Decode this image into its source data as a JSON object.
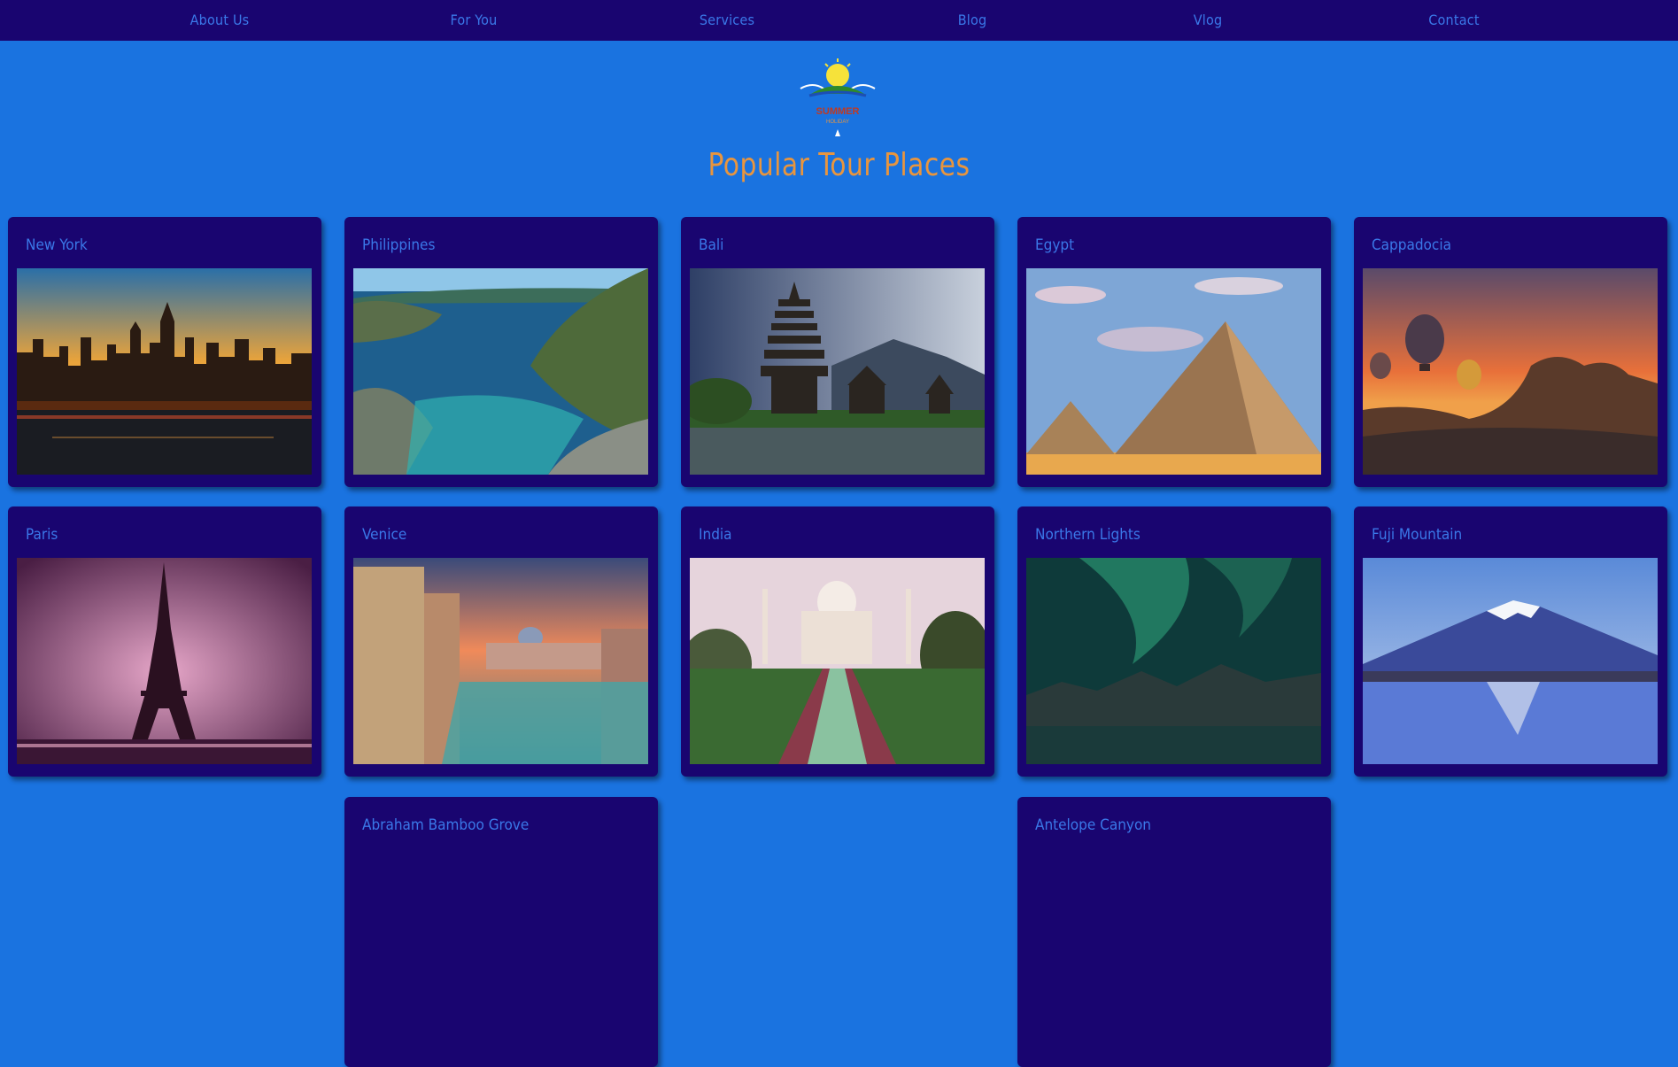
{
  "nav": {
    "items": [
      {
        "label": "About Us"
      },
      {
        "label": "For You"
      },
      {
        "label": "Services"
      },
      {
        "label": "Blog"
      },
      {
        "label": "Vlog"
      },
      {
        "label": "Contact"
      }
    ]
  },
  "logo": {
    "text_main": "SUMMER",
    "text_sub": "HOLIDAY"
  },
  "page_title": "Popular Tour Places",
  "places": [
    {
      "name": "New York"
    },
    {
      "name": "Philippines"
    },
    {
      "name": "Bali"
    },
    {
      "name": "Egypt"
    },
    {
      "name": "Cappadocia"
    },
    {
      "name": "Paris"
    },
    {
      "name": "Venice"
    },
    {
      "name": "India"
    },
    {
      "name": "Northern Lights"
    },
    {
      "name": "Fuji Mountain"
    },
    {
      "name": "Abraham Bamboo Grove"
    },
    {
      "name": "Antelope Canyon"
    }
  ],
  "colors": {
    "page_bg": "#1a73e0",
    "nav_bg": "#190570",
    "card_bg": "#190570",
    "link_color": "#3a78e8",
    "title_color": "#e8953e"
  }
}
